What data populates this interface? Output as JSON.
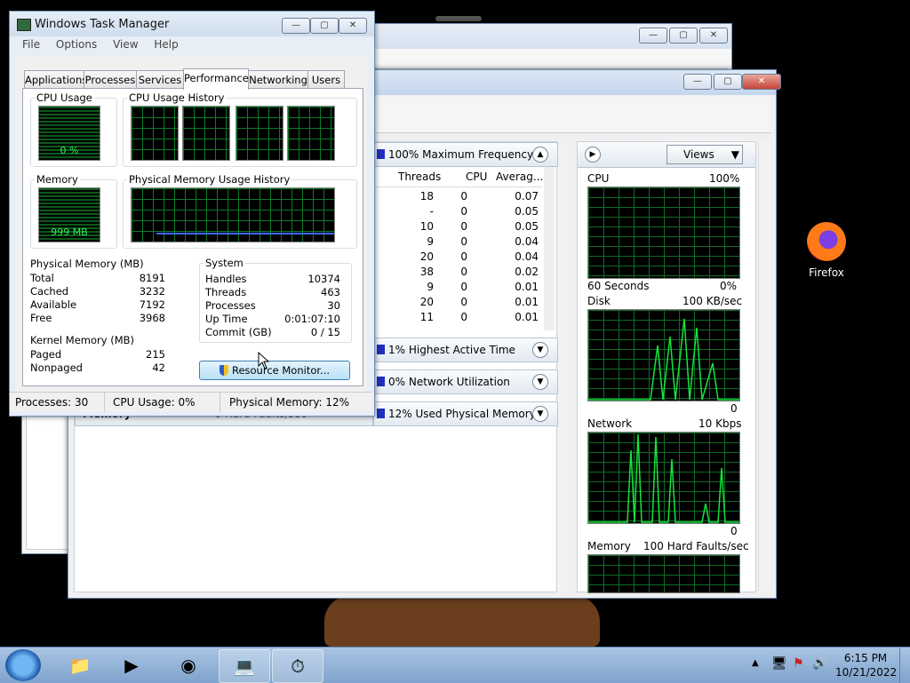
{
  "task_manager": {
    "title": "Windows Task Manager",
    "menu": [
      "File",
      "Options",
      "View",
      "Help"
    ],
    "tabs": [
      "Applications",
      "Processes",
      "Services",
      "Performance",
      "Networking",
      "Users"
    ],
    "active_tab": "Performance",
    "cpu_usage_label": "CPU Usage",
    "cpu_usage_value": "0 %",
    "cpu_history_label": "CPU Usage History",
    "memory_label": "Memory",
    "memory_value": "999 MB",
    "phys_history_label": "Physical Memory Usage History",
    "physical_memory": {
      "title": "Physical Memory (MB)",
      "rows": [
        {
          "label": "Total",
          "value": "8191"
        },
        {
          "label": "Cached",
          "value": "3232"
        },
        {
          "label": "Available",
          "value": "7192"
        },
        {
          "label": "Free",
          "value": "3968"
        }
      ]
    },
    "system": {
      "title": "System",
      "rows": [
        {
          "label": "Handles",
          "value": "10374"
        },
        {
          "label": "Threads",
          "value": "463"
        },
        {
          "label": "Processes",
          "value": "30"
        },
        {
          "label": "Up Time",
          "value": "0:01:07:10"
        },
        {
          "label": "Commit (GB)",
          "value": "0 / 15"
        }
      ]
    },
    "kernel_memory": {
      "title": "Kernel Memory (MB)",
      "rows": [
        {
          "label": "Paged",
          "value": "215"
        },
        {
          "label": "Nonpaged",
          "value": "42"
        }
      ]
    },
    "resource_monitor_button": "Resource Monitor...",
    "status": {
      "processes": "Processes: 30",
      "cpu": "CPU Usage: 0%",
      "memory": "Physical Memory: 12%"
    }
  },
  "resource_monitor": {
    "sections": [
      "100% Maximum Frequency",
      "1% Highest Active Time",
      "0% Network Utilization",
      "12% Used Physical Memory"
    ],
    "columns": [
      "Threads",
      "CPU",
      "Averag..."
    ],
    "rows": [
      [
        "18",
        "0",
        "0.07"
      ],
      [
        "-",
        "0",
        "0.05"
      ],
      [
        "10",
        "0",
        "0.05"
      ],
      [
        "9",
        "0",
        "0.04"
      ],
      [
        "20",
        "0",
        "0.04"
      ],
      [
        "38",
        "0",
        "0.02"
      ],
      [
        "9",
        "0",
        "0.01"
      ],
      [
        "20",
        "0",
        "0.01"
      ],
      [
        "11",
        "0",
        "0.01"
      ]
    ],
    "memory_heading": "Memory",
    "memory_sub": "0 Hard Faults/sec",
    "views_button": "Views",
    "graphs": {
      "cpu": {
        "label": "CPU",
        "max": "100%",
        "time": "60 Seconds",
        "min": "0%"
      },
      "disk": {
        "label": "Disk",
        "max": "100 KB/sec",
        "min": "0"
      },
      "network": {
        "label": "Network",
        "max": "10 Kbps",
        "min": "0"
      },
      "memory": {
        "label": "Memory",
        "max": "100 Hard Faults/sec"
      }
    }
  },
  "desktop": {
    "firefox_label": "Firefox"
  },
  "taskbar": {
    "time": "6:15 PM",
    "date": "10/21/2022"
  }
}
